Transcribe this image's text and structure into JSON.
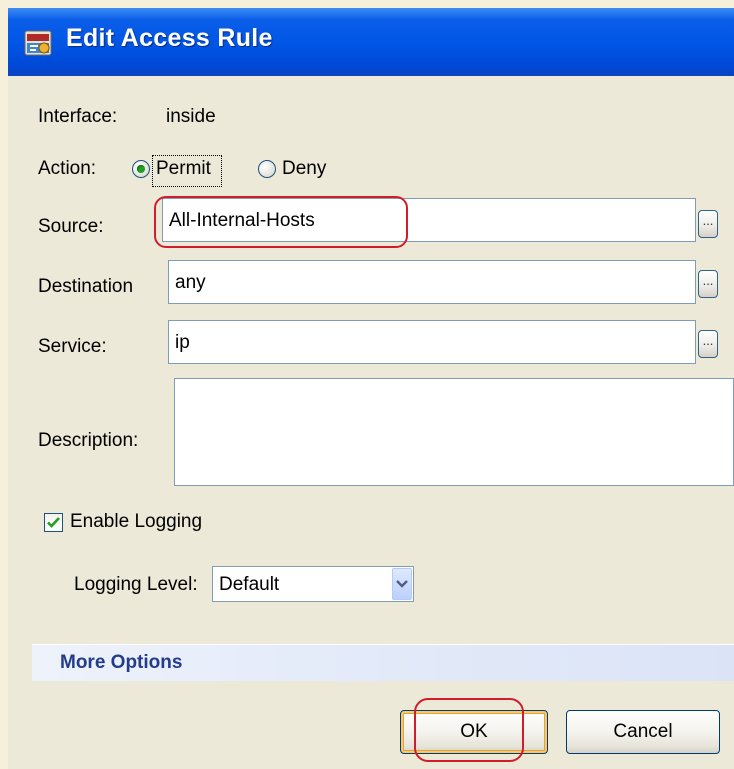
{
  "window": {
    "title": "Edit Access Rule",
    "icon": "asdm-app-icon"
  },
  "interface": {
    "label": "Interface:",
    "value": "inside"
  },
  "action": {
    "label": "Action:",
    "options": [
      {
        "label": "Permit",
        "selected": true
      },
      {
        "label": "Deny",
        "selected": false
      }
    ]
  },
  "source": {
    "label": "Source:",
    "value": "All-Internal-Hosts",
    "browse_label": "..."
  },
  "destination": {
    "label": "Destination",
    "value": "any",
    "browse_label": "..."
  },
  "service": {
    "label": "Service:",
    "value": "ip",
    "browse_label": "..."
  },
  "description": {
    "label": "Description:",
    "value": ""
  },
  "logging": {
    "enable_label": "Enable Logging",
    "enabled": true,
    "level_label": "Logging Level:",
    "level_value": "Default"
  },
  "more_options": {
    "label": "More Options"
  },
  "buttons": {
    "ok": "OK",
    "cancel": "Cancel"
  },
  "colors": {
    "titlebar": "#0055e5",
    "dialog_bg": "#ece9d8",
    "highlight": "#d11d2a",
    "radio_selected": "#21a121",
    "more_options_text": "#233d8a"
  }
}
